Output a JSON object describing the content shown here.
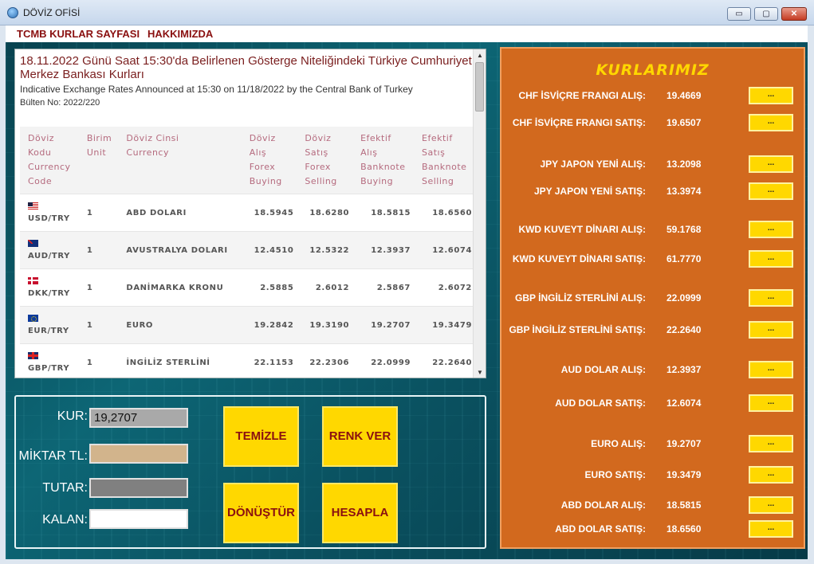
{
  "window": {
    "title": "DÖVİZ OFİSİ",
    "controls": {
      "minimize": "▭",
      "maximize": "▢",
      "close": "✕"
    }
  },
  "menu": {
    "items": [
      "TCMB KURLAR SAYFASI",
      "HAKKIMIZDA"
    ]
  },
  "web": {
    "title": "18.11.2022 Günü Saat 15:30'da Belirlenen Gösterge Niteliğindeki Türkiye Cumhuriyet Merkez Bankası Kurları",
    "subtitle": "Indicative Exchange Rates Announced at 15:30 on 11/18/2022 by the Central Bank of Turkey",
    "bulletin": "Bülten No: 2022/220",
    "headers": [
      [
        "Döviz",
        "Kodu",
        "Currency",
        "Code"
      ],
      [
        "Birim",
        "Unit"
      ],
      [
        "Döviz Cinsi",
        "Currency"
      ],
      [
        "Döviz",
        "Alış",
        "Forex",
        "Buying"
      ],
      [
        "Döviz",
        "Satış",
        "Forex",
        "Selling"
      ],
      [
        "Efektif",
        "Alış",
        "Banknote",
        "Buying"
      ],
      [
        "Efektif",
        "Satış",
        "Banknote",
        "Selling"
      ]
    ],
    "rows": [
      {
        "flag": "us",
        "code": "USD/TRY",
        "unit": "1",
        "name": "ABD DOLARI",
        "fb": "18.5945",
        "fs": "18.6280",
        "bb": "18.5815",
        "bs": "18.6560"
      },
      {
        "flag": "au",
        "code": "AUD/TRY",
        "unit": "1",
        "name": "AVUSTRALYA DOLARI",
        "fb": "12.4510",
        "fs": "12.5322",
        "bb": "12.3937",
        "bs": "12.6074"
      },
      {
        "flag": "dk",
        "code": "DKK/TRY",
        "unit": "1",
        "name": "DANİMARKA KRONU",
        "fb": "2.5885",
        "fs": "2.6012",
        "bb": "2.5867",
        "bs": "2.6072"
      },
      {
        "flag": "eu",
        "code": "EUR/TRY",
        "unit": "1",
        "name": "EURO",
        "fb": "19.2842",
        "fs": "19.3190",
        "bb": "19.2707",
        "bs": "19.3479"
      },
      {
        "flag": "gb",
        "code": "GBP/TRY",
        "unit": "1",
        "name": "İNGİLİZ STERLİNİ",
        "fb": "22.1153",
        "fs": "22.2306",
        "bb": "22.0999",
        "bs": "22.2640"
      }
    ],
    "scroll": {
      "up": "▲",
      "down": "▼"
    }
  },
  "calc": {
    "kur_label": "KUR:",
    "kur_value": "19,2707",
    "miktar_label": "MİKTAR TL:",
    "miktar_value": "",
    "tutar_label": "TUTAR:",
    "tutar_value": "",
    "kalan_label": "KALAN:",
    "kalan_value": "",
    "buttons": {
      "temizle": "TEMİZLE",
      "renk_ver": "RENK VER",
      "donustur": "DÖNÜŞTÜR",
      "hesapla": "HESAPLA"
    },
    "colors": {
      "kur_bg": "#a9a9a9",
      "miktar_bg": "#d2b48c",
      "tutar_bg": "#808080",
      "kalan_bg": "#ffffff"
    }
  },
  "rates": {
    "title": "KURLARIMIZ",
    "items": [
      {
        "label": "CHF İSVİÇRE FRANGI ALIŞ:",
        "value": "19.4669",
        "button": "..."
      },
      {
        "label": "CHF İSVİÇRE FRANGI SATIŞ:",
        "value": "19.6507",
        "button": "..."
      },
      {
        "label": "JPY JAPON YENİ ALIŞ:",
        "value": "13.2098",
        "button": "..."
      },
      {
        "label": "JPY JAPON YENİ SATIŞ:",
        "value": "13.3974",
        "button": "..."
      },
      {
        "label": "KWD KUVEYT DİNARI ALIŞ:",
        "value": "59.1768",
        "button": "..."
      },
      {
        "label": "KWD KUVEYT DİNARI SATIŞ:",
        "value": "61.7770",
        "button": "..."
      },
      {
        "label": "GBP İNGİLİZ STERLİNİ ALIŞ:",
        "value": "22.0999",
        "button": "..."
      },
      {
        "label": "GBP İNGİLİZ STERLİNİ SATIŞ:",
        "value": "22.2640",
        "button": "..."
      },
      {
        "label": "AUD DOLAR ALIŞ:",
        "value": "12.3937",
        "button": "..."
      },
      {
        "label": "AUD DOLAR SATIŞ:",
        "value": "12.6074",
        "button": "..."
      },
      {
        "label": "EURO ALIŞ:",
        "value": "19.2707",
        "button": "..."
      },
      {
        "label": "EURO SATIŞ:",
        "value": "19.3479",
        "button": "..."
      },
      {
        "label": "ABD DOLAR ALIŞ:",
        "value": "18.5815",
        "button": "..."
      },
      {
        "label": "ABD DOLAR SATIŞ:",
        "value": "18.6560",
        "button": "..."
      }
    ]
  }
}
